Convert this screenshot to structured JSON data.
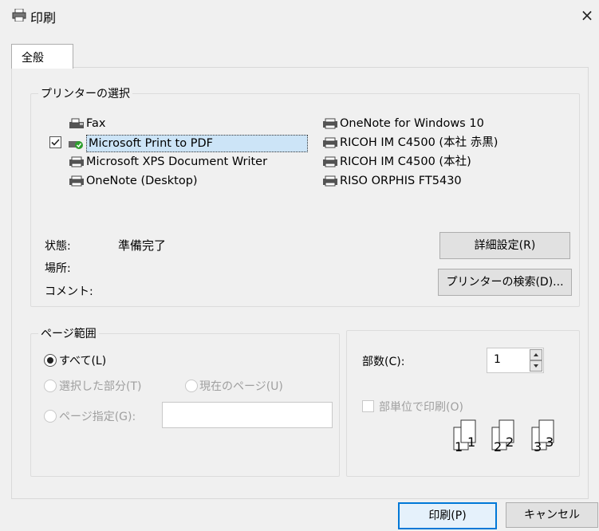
{
  "window": {
    "title": "印刷",
    "close_label": "×"
  },
  "tabs": [
    {
      "label": "全般"
    }
  ],
  "printer_section": {
    "title": "プリンターの選択",
    "printers_left": [
      {
        "name": "Fax"
      },
      {
        "name": "Microsoft Print to PDF",
        "selected": true,
        "default": true
      },
      {
        "name": "Microsoft XPS Document Writer"
      },
      {
        "name": "OneNote (Desktop)"
      }
    ],
    "printers_right": [
      {
        "name": "OneNote for Windows 10"
      },
      {
        "name": "RICOH IM C4500 (本社 赤黒)"
      },
      {
        "name": "RICOH IM C4500 (本社)"
      },
      {
        "name": "RISO ORPHIS FT5430"
      }
    ],
    "status_label": "状態:",
    "status_value": "準備完了",
    "location_label": "場所:",
    "comment_label": "コメント:",
    "preferences_button": "詳細設定(R)",
    "find_printer_button": "プリンターの検索(D)..."
  },
  "page_range": {
    "title": "ページ範囲",
    "all": "すべて(L)",
    "selection": "選択した部分(T)",
    "current_page": "現在のページ(U)",
    "pages": "ページ指定(G):",
    "pages_value": ""
  },
  "copies": {
    "label": "部数(C):",
    "value": "1",
    "collate_label": "部単位で印刷(O)",
    "collate_checked": false
  },
  "buttons": {
    "print": "印刷(P)",
    "cancel": "キャンセル"
  }
}
